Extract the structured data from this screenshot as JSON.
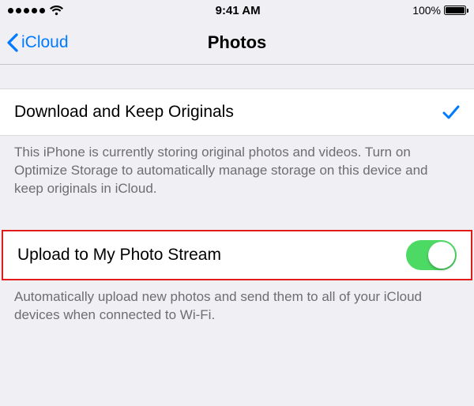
{
  "status": {
    "time": "9:41 AM",
    "battery_pct": "100%"
  },
  "nav": {
    "back_label": "iCloud",
    "title": "Photos"
  },
  "rows": {
    "download_originals": {
      "label": "Download and Keep Originals",
      "footer": "This iPhone is currently storing original photos and videos. Turn on Optimize Storage to automatically manage storage on this device and keep originals in iCloud."
    },
    "photo_stream": {
      "label": "Upload to My Photo Stream",
      "footer": "Automatically upload new photos and send them to all of your iCloud devices when connected to Wi-Fi."
    }
  }
}
